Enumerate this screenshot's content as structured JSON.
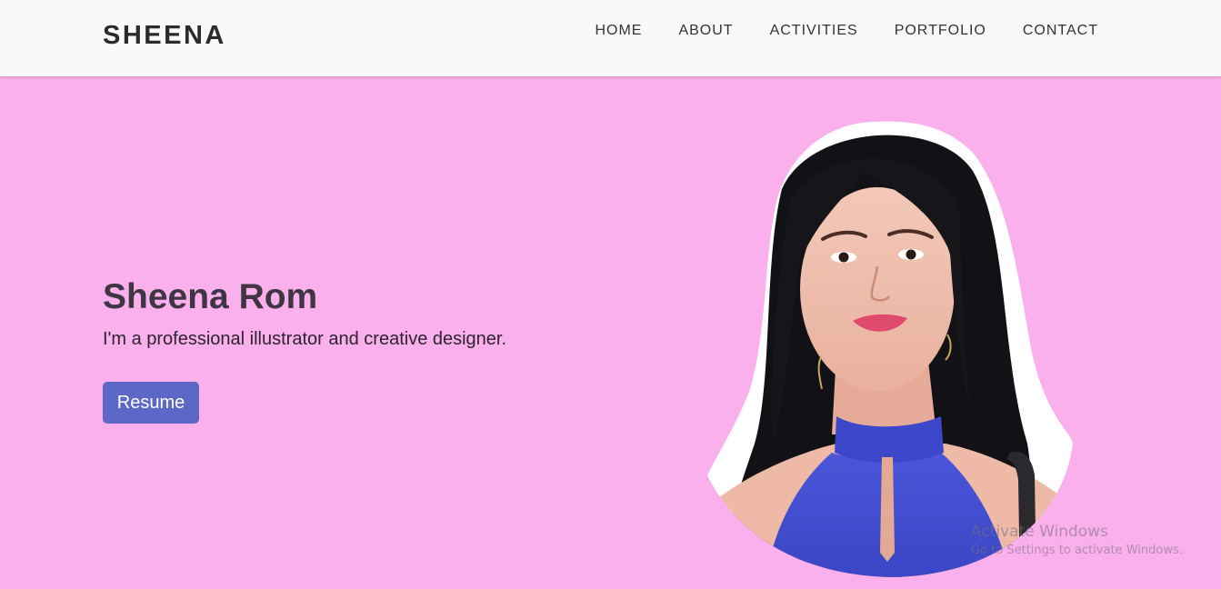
{
  "brand": "SHEENA",
  "nav": {
    "items": [
      {
        "label": "HOME"
      },
      {
        "label": "ABOUT"
      },
      {
        "label": "ACTIVITIES"
      },
      {
        "label": "PORTFOLIO"
      },
      {
        "label": "CONTACT"
      }
    ]
  },
  "hero": {
    "name": "Sheena Rom",
    "tagline": "I'm a professional illustrator and creative designer.",
    "button_label": "Resume",
    "background_color": "#f9b0ec",
    "button_color": "#5d67c6"
  },
  "watermark": {
    "title": "Activate Windows",
    "subtitle": "Go to Settings to activate Windows."
  }
}
